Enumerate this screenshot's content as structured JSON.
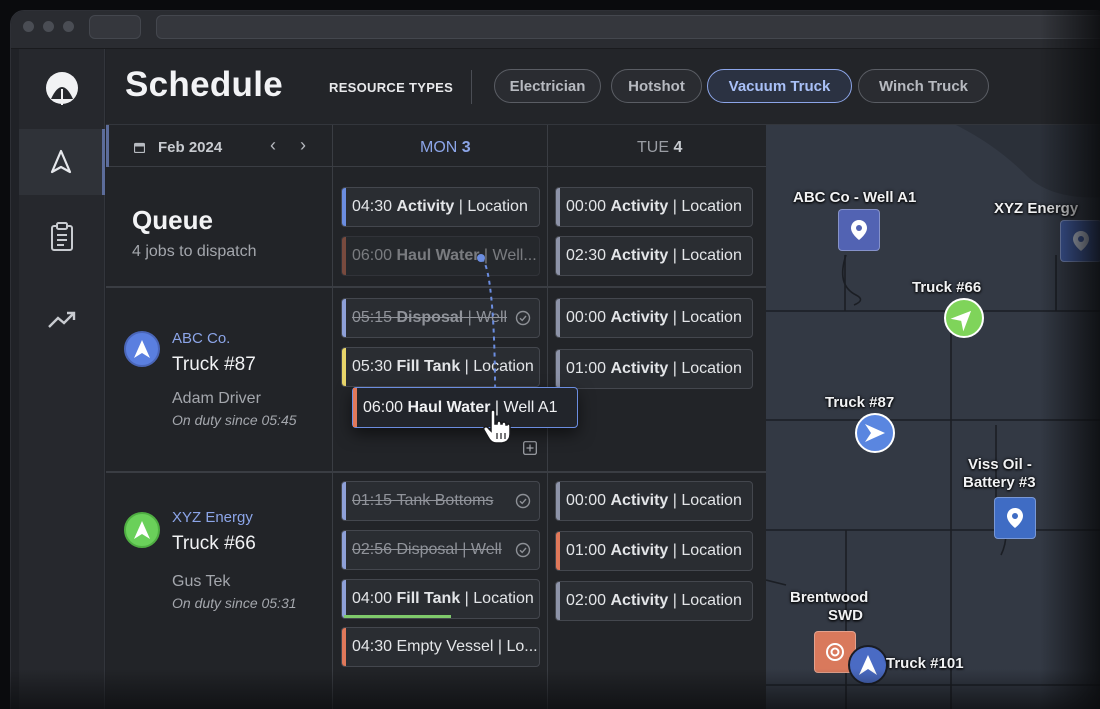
{
  "header": {
    "title": "Schedule",
    "resource_types_label": "RESOURCE TYPES",
    "chips": [
      {
        "label": "Electrician",
        "selected": false
      },
      {
        "label": "Hotshot",
        "selected": false
      },
      {
        "label": "Vacuum Truck",
        "selected": true
      },
      {
        "label": "Winch Truck",
        "selected": false
      }
    ]
  },
  "sidebar": {
    "items": [
      {
        "icon": "logo-icon"
      },
      {
        "icon": "navigation-arrow-icon",
        "active": true
      },
      {
        "icon": "clipboard-icon"
      },
      {
        "icon": "trending-up-icon"
      }
    ]
  },
  "calendar": {
    "month": "Feb 2024",
    "days": [
      {
        "name": "MON",
        "num": "3",
        "today": true
      },
      {
        "name": "TUE",
        "num": "4",
        "today": false
      }
    ]
  },
  "queue": {
    "title": "Queue",
    "subtitle": "4 jobs to dispatch",
    "mon": [
      {
        "time": "04:30",
        "name": "Activity",
        "loc": "Location",
        "color": "#6b8de0"
      },
      {
        "time": "06:00",
        "name": "Haul Water",
        "loc": "Well...",
        "color": "#e0785a",
        "ghost": true
      }
    ],
    "tue": [
      {
        "time": "00:00",
        "name": "Activity",
        "loc": "Location",
        "color": "#8d93a8"
      },
      {
        "time": "02:30",
        "name": "Activity",
        "loc": "Location",
        "color": "#8d93a8"
      }
    ]
  },
  "resources": [
    {
      "company": "ABC Co.",
      "truck": "Truck #87",
      "driver": "Adam Driver",
      "status": "On duty since 05:45",
      "icon_color": "#5a7fe0",
      "mon": [
        {
          "time": "05:15",
          "name": "Disposal",
          "loc": "Well",
          "color": "#8ea0d8",
          "done": true
        },
        {
          "time": "05:30",
          "name": "Fill Tank",
          "loc": "Location",
          "color": "#e8d56a"
        }
      ],
      "tue": [
        {
          "time": "00:00",
          "name": "Activity",
          "loc": "Location",
          "color": "#8d93a8"
        },
        {
          "time": "01:00",
          "name": "Activity",
          "loc": "Location",
          "color": "#8d93a8"
        }
      ]
    },
    {
      "company": "XYZ Energy",
      "truck": "Truck #66",
      "driver": "Gus Tek",
      "status": "On duty since 05:31",
      "icon_color": "#6ad05a",
      "mon": [
        {
          "time": "01:15",
          "name": "Tank Bottoms",
          "loc": "",
          "color": "#8ea0d8",
          "done": true
        },
        {
          "time": "02:56",
          "name": "Disposal",
          "loc": "Well",
          "color": "#8ea0d8",
          "done": true
        },
        {
          "time": "04:00",
          "name": "Fill Tank",
          "loc": "Location",
          "color": "#8ea0d8",
          "progress": 0.55
        },
        {
          "time": "04:30",
          "name": "Empty Vessel",
          "loc": "Lo...",
          "color": "#e0785a",
          "plain": true
        }
      ],
      "tue": [
        {
          "time": "00:00",
          "name": "Activity",
          "loc": "Location",
          "color": "#8d93a8"
        },
        {
          "time": "01:00",
          "name": "Activity",
          "loc": "Location",
          "color": "#e0785a"
        },
        {
          "time": "02:00",
          "name": "Activity",
          "loc": "Location",
          "color": "#8d93a8"
        }
      ]
    }
  ],
  "drag": {
    "time": "06:00",
    "name": "Haul Water",
    "loc": "Well A1"
  },
  "map": {
    "labels": [
      "ABC Co - Well A1",
      "XYZ Energy",
      "Truck #66",
      "Truck #87",
      "Viss Oil -",
      "Battery #3",
      "Brentwood",
      "SWD",
      "Truck #101"
    ],
    "colors": {
      "pin": "#5263b3",
      "pin_blue": "#3f6cc4",
      "pin_orange": "#d9795c",
      "truck_green": "#7fd45a",
      "truck_blue": "#5a86e0"
    }
  }
}
